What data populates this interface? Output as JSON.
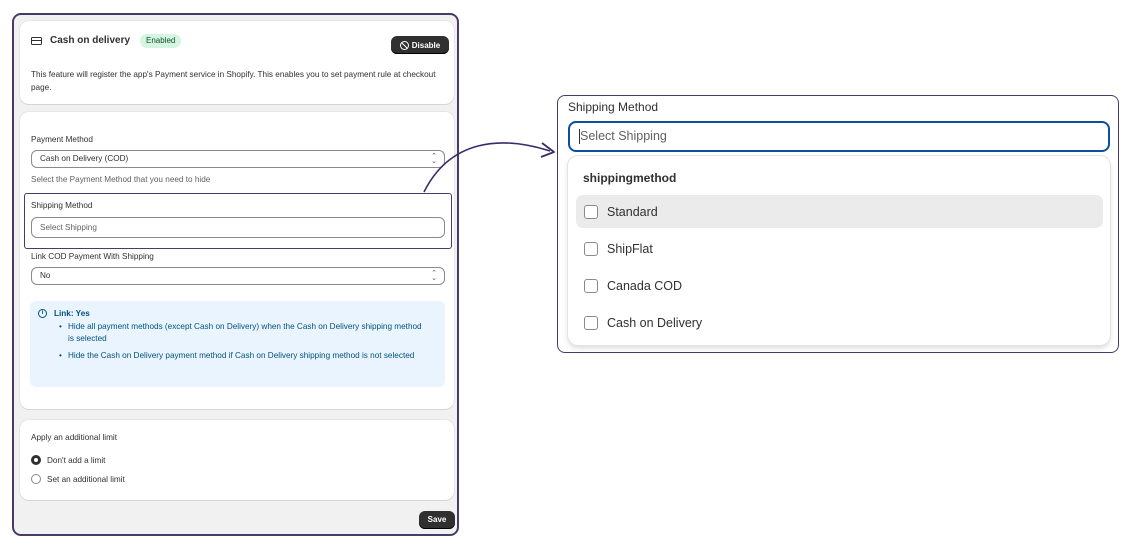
{
  "cod_card": {
    "title": "Cash on delivery",
    "badge": "Enabled",
    "disable_label": "Disable",
    "description": "This feature will register the app's Payment service in Shopify. This enables you to set payment rule at checkout page."
  },
  "payment_method": {
    "label": "Payment Method",
    "value": "Cash on Delivery (COD)",
    "help": "Select the Payment Method that you need to hide"
  },
  "shipping_method": {
    "label": "Shipping Method",
    "placeholder": "Select Shipping"
  },
  "link_cod": {
    "label": "Link COD Payment With Shipping",
    "value": "No"
  },
  "info_banner": {
    "title": "Link: Yes",
    "items": [
      "Hide all payment methods (except Cash on Delivery) when the Cash on Delivery shipping method is selected",
      "Hide the Cash on Delivery payment method if Cash on Delivery shipping method is not selected"
    ]
  },
  "limit": {
    "label": "Apply an additional limit",
    "options": [
      "Don't add a limit",
      "Set an additional limit"
    ],
    "selected_index": 0
  },
  "save_label": "Save",
  "zoom_panel": {
    "label": "Shipping Method",
    "placeholder": "Select Shipping",
    "group_heading": "shippingmethod",
    "options": [
      "Standard",
      "ShipFlat",
      "Canada COD",
      "Cash on Delivery"
    ],
    "highlighted_index": 0
  },
  "colors": {
    "frame_border": "#4a3a6b",
    "focus_border": "#0d4f9e",
    "banner_bg": "#eaf4ff",
    "badge_bg": "#d6f5e0"
  }
}
